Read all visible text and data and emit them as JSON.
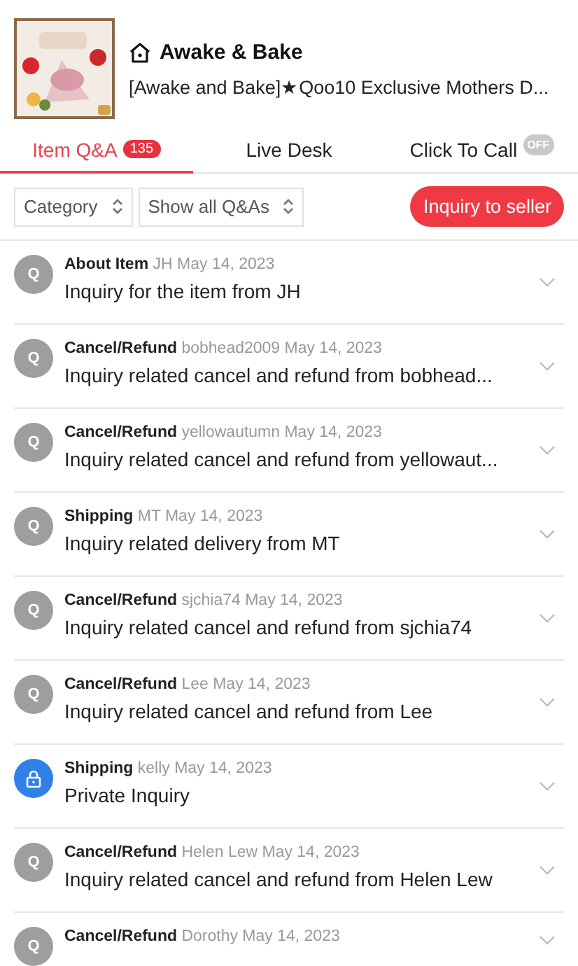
{
  "shop": {
    "name": "Awake & Bake",
    "item_title": "[Awake and Bake]★Qoo10 Exclusive Mothers D..."
  },
  "tabs": [
    {
      "label": "Item Q&A",
      "badge": "135",
      "selected": true
    },
    {
      "label": "Live Desk",
      "selected": false
    },
    {
      "label": "Click To Call",
      "badge": "OFF",
      "selected": false
    }
  ],
  "filters": [
    {
      "label": "Category"
    },
    {
      "label": "Show all Q&As"
    }
  ],
  "inquiry_button": "Inquiry to seller",
  "questions": [
    {
      "kind": "public",
      "avatar": "Q",
      "category": "About Item",
      "author": "JH",
      "date": "May 14, 2023",
      "text": "Inquiry for the item from JH"
    },
    {
      "kind": "public",
      "avatar": "Q",
      "category": "Cancel/Refund",
      "author": "bobhead2009",
      "date": "May 14, 2023",
      "text": "Inquiry related cancel and refund from bobhead..."
    },
    {
      "kind": "public",
      "avatar": "Q",
      "category": "Cancel/Refund",
      "author": "yellowautumn",
      "date": "May 14, 2023",
      "text": "Inquiry related cancel and refund from yellowaut..."
    },
    {
      "kind": "public",
      "avatar": "Q",
      "category": "Shipping",
      "author": "MT",
      "date": "May 14, 2023",
      "text": "Inquiry related delivery from MT"
    },
    {
      "kind": "public",
      "avatar": "Q",
      "category": "Cancel/Refund",
      "author": "sjchia74",
      "date": "May 14, 2023",
      "text": "Inquiry related cancel and refund from sjchia74"
    },
    {
      "kind": "public",
      "avatar": "Q",
      "category": "Cancel/Refund",
      "author": "Lee",
      "date": "May 14, 2023",
      "text": "Inquiry related cancel and refund from Lee"
    },
    {
      "kind": "private",
      "category": "Shipping",
      "author": "kelly",
      "date": "May 14, 2023",
      "text": "Private Inquiry"
    },
    {
      "kind": "public",
      "avatar": "Q",
      "category": "Cancel/Refund",
      "author": "Helen Lew",
      "date": "May 14, 2023",
      "text": "Inquiry related cancel and refund from Helen Lew"
    },
    {
      "kind": "public",
      "avatar": "Q",
      "category": "Cancel/Refund",
      "author": "Dorothy",
      "date": "May 14, 2023"
    }
  ]
}
